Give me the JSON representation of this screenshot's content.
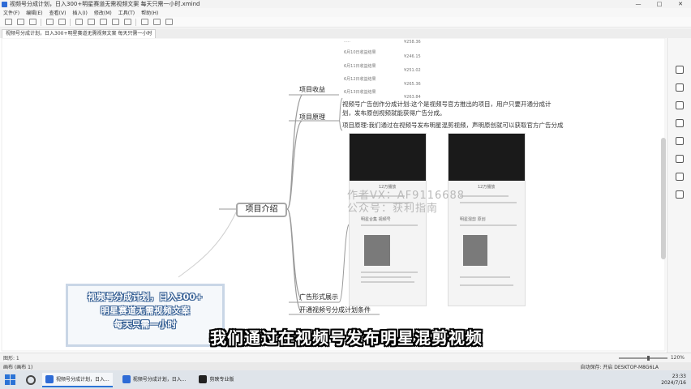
{
  "window": {
    "title": "视频号分成计划，日入300+明星赛道无需视频文案 每天只需一小时.xmind",
    "controls": [
      "—",
      "□",
      "✕"
    ]
  },
  "menu": [
    "文件(F)",
    "编辑(E)",
    "查看(V)",
    "插入(I)",
    "修改(M)",
    "工具(T)",
    "帮助(H)"
  ],
  "doc_tab": "视频号分成计划，日入300+明星赛道无需视频文案 每天只需一小时",
  "mindmap": {
    "root": "项目介绍",
    "branches": {
      "income": "项目收益",
      "principle": "项目原理",
      "ad_display": "广告形式展示",
      "conditions": "开通视频号分成计划条件"
    },
    "principle_text_1": "视频号广告创作分成计划:这个是视频号官方推出的项目，用户只要开通分成计划，发布原创视频就能获得广告分成。",
    "principle_text_2": "项目原理:我们通过在视频号发布明星混剪视频，声明原创就可以获取官方广告分成",
    "earnings": [
      {
        "label": "¥258.36"
      },
      {
        "label": "6月10日收益结果",
        "value": "¥246.15"
      },
      {
        "label": "6月11日收益结果",
        "value": "¥251.02"
      },
      {
        "label": "6月12日收益结果",
        "value": "¥265.36"
      },
      {
        "label": "6月13日收益结果",
        "value": "¥263.84"
      }
    ],
    "phone_captions": {
      "left_video": "12万播放",
      "right_video": "12万播放",
      "left_comment": "明星合集 视频号",
      "right_comment": "明星混剪 原创"
    }
  },
  "watermark": {
    "line1": "作者VX：AF9116688",
    "line2": "公众号：获利指南"
  },
  "promo_box": {
    "line1": "视频号分成计划，日入300+",
    "line2": "明星赛道无需视频文案",
    "line3": "每天只需一小时"
  },
  "subtitle": "我们通过在视频号发布明星混剪视频",
  "statusbar": {
    "left": "图形: 1",
    "zoom": "120%"
  },
  "taskbar2": {
    "left": "画布 (画布 1)",
    "right": "自动保存: 开启  DESKTOP-M8G6LA"
  },
  "taskbar": {
    "tasks": [
      {
        "label": "视频号分成计划，日入..."
      },
      {
        "label": "视频号分成计划，日入..."
      },
      {
        "label": "剪映专业版"
      }
    ],
    "clock_time": "23:33",
    "clock_date": "2024/7/16"
  }
}
